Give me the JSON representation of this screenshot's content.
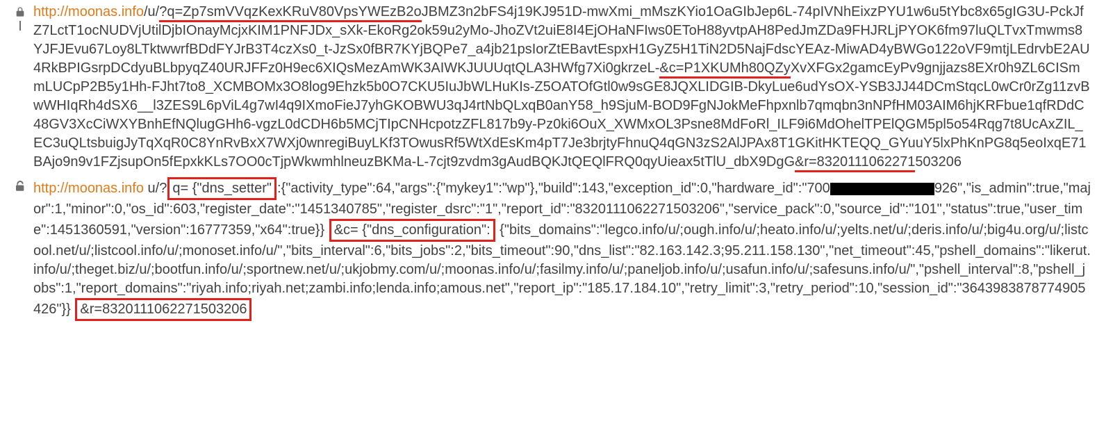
{
  "entries": [
    {
      "locked": true,
      "url_link": "http://moonas.info",
      "segments": [
        {
          "t": "/u/",
          "style": "plain"
        },
        {
          "t": "?q=Zp7smVVqzKexKRuV80VpsYWEzB2o",
          "style": "under-red"
        },
        {
          "t": "JBMZ3n2bFS4j19KJ951D-mwXmi_mMszKYio1OaGIbJep6L-74pIVNhEixzPYU1w6u5tYbc8x65gIG3U-PckJfZ7LctT1ocNUDVjUtilDjbIOnayMcjxKIM1PNFJDx_sXk-EkoRg2ok59u2yMo-JhoZVt2uiE8I4EjOHaNFIws0EToH88yvtpAH8PedJmZDa9FHJRLjPYOK6fm97luQLTvxTmwms8YJFJEvu67Loy8LTktwwrfBDdFYJrB3T4czXs0_t-JzSx0fBR7KYjBQPe7_a4jb21psIorZtEBavtEspxH1GyZ5H1TiN2D5NajFdscYEAz-MiwAD4yBWGo122oVF9mtjLEdrvbE2AU4RkBPIGsrpDCdyuBLbpyqZ40URJFFz0H9ec6XIQsMezAmWK3AIWKJUUUqtQLA3HWfg7Xi0gkrzeL-",
          "style": "plain"
        },
        {
          "t": "&c=P1XKUMh80QZy",
          "style": "under-red"
        },
        {
          "t": "XvXFGx2gamcEyPv9gnjjazs8EXr0h9ZL6CISmmLUCpP2B5y1Hh-FJht7to8_XCMBOMx3O8log9Ehzk5b0O7CKU5IuJbWLHuKIs-Z5OATOfGtl0w9sGE8JQXLIDGIB-DkyLue6udYsOX-YSB3JJ44DCmStqcL0wCr0rZg11zvBwWHIqRh4dSX6__l3ZES9L6pViL4g7wI4q9IXmoFieJ7yhGKOBWU3qJ4rtNbQLxqB0anY58_h9SjuM-BOD9FgNJokMeFhpxnlb7qmqbn3nNPfHM03AIM6hjKRFbue1qfRDdC48GV3XcCiWXYBnhEfNQlugGHh6-vgzL0dCDH6b5MCjTIpCNHcpotzZFL817b9y-Pz0ki6OuX_XWMxOL3Psne8MdFoRl_ILF9i6MdOhelTPElQGM5pl5o54Rqg7t8UcAxZIL_EC3uQLtsbuigJyTqXqR0C8YnRvBxX7WXj0wnregiBuyLKf3TOwusRf5WtXdEsKm4pT7Je3brjtyFhnuQ4qGN3zS2AlJPAx8T1GKitHKTEQQ_GYuuY5lxPhKnPG8q5eoIxqE71BAjo9n9v1FZjsupOn5fEpxkKLs7OO0cTjpWkwmhlneuzBKMa-L-7cjt9zvdm3gAudBQKJtQEQlFRQ0qyUieax5tTlU_dbX9DgG",
          "style": "plain"
        },
        {
          "t": "&r=8320111062271",
          "style": "under-red"
        },
        {
          "t": "503206",
          "style": "plain"
        }
      ]
    },
    {
      "locked": false,
      "url_link": "http://moonas.info",
      "segments": [
        {
          "t": " u/?",
          "style": "plain"
        },
        {
          "t": "q= {\"dns_setter\"",
          "style": "box-red"
        },
        {
          "t": ":{\"activity_type\":64,\"args\":{\"mykey1\":\"wp\"},\"build\":143,\"exception_id\":0,\"hardware_id\":\"700",
          "style": "plain"
        },
        {
          "t": "",
          "style": "redact"
        },
        {
          "t": "926\",\"is_admin\":true,\"major\":1,\"minor\":0,\"os_id\":603,\"register_date\":\"1451340785\",\"register_dsrc\":\"1\",\"report_id\":\"8320111062271503206\",\"service_pack\":0,\"source_id\":\"101\",\"status\":true,\"user_time\":1451360591,\"version\":16777359,\"x64\":true}} ",
          "style": "plain"
        },
        {
          "t": "&c= {\"dns_configuration\":",
          "style": "box-red"
        },
        {
          "t": " {\"bits_domains\":\"legco.info/u/;ough.info/u/;heato.info/u/;yelts.net/u/;deris.info/u/;big4u.org/u/;listcool.net/u/;listcool.info/u/;monoset.info/u/\",\"bits_interval\":6,\"bits_jobs\":2,\"bits_timeout\":90,\"dns_list\":\"82.163.142.3;95.211.158.130\",\"net_timeout\":45,\"pshell_domains\":\"likerut.info/u/;theget.biz/u/;bootfun.info/u/;sportnew.net/u/;ukjobmy.com/u/;moonas.info/u/;fasilmy.info/u/;paneljob.info/u/;usafun.info/u/;safesuns.info/u/\",\"pshell_interval\":8,\"pshell_jobs\":1,\"report_domains\":\"riyah.info;riyah.net;zambi.info;lenda.info;amous.net\",\"report_ip\":\"185.17.184.10\",\"retry_limit\":3,\"retry_period\":10,\"session_id\":\"3643983878774905426\"}} ",
          "style": "plain"
        },
        {
          "t": "&r=8320111062271503206",
          "style": "box-red"
        }
      ]
    }
  ]
}
